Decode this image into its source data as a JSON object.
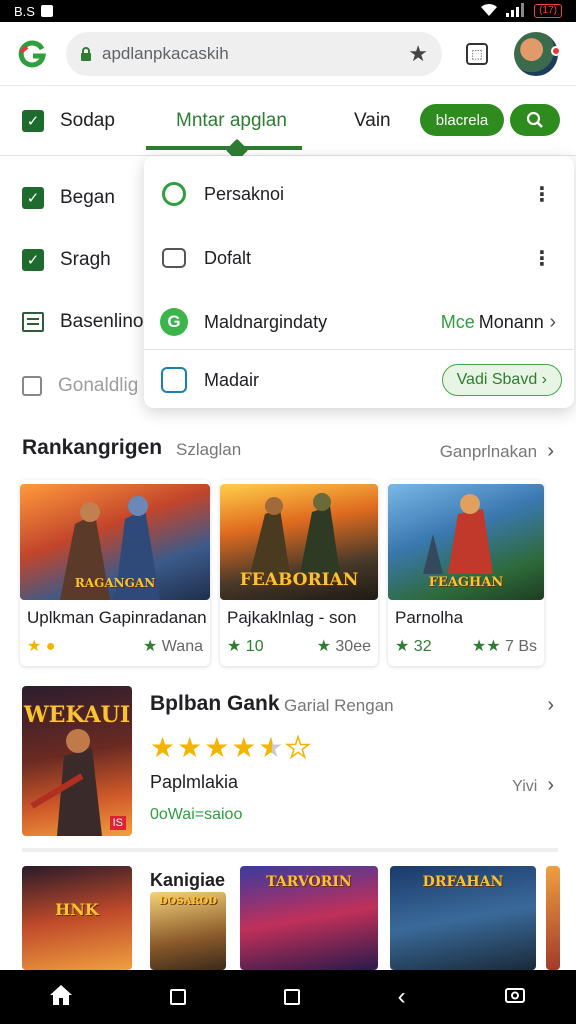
{
  "status_bar": {
    "left_text": "B.S",
    "battery": "(17)"
  },
  "browser": {
    "url": "apdlanpkacaskih",
    "star_icon": "star-icon",
    "tabs_icon": "tabs-icon"
  },
  "tabs": {
    "item1": "Sodap",
    "active": "Mntar apglan",
    "item3": "Vain",
    "pill": "blacrela"
  },
  "side": {
    "items": [
      "Began",
      "Sragh",
      "Basenlino",
      "Gonaldlig"
    ]
  },
  "dropdown": {
    "rows": [
      {
        "label": "Persaknoi"
      },
      {
        "label": "Dofalt"
      },
      {
        "label": "Maldnargindaty",
        "right_green": "Mce",
        "right_text": "Monann"
      },
      {
        "label": "Madair",
        "pill": "Vadi Sbavd"
      }
    ]
  },
  "section": {
    "title": "Rankangrigen",
    "subtitle": "Szlaglan",
    "link": "Ganprlnakan"
  },
  "cards": [
    {
      "art_text": "RAGANGAN",
      "title": "Uplkman Gapinradanan",
      "rating": "",
      "meta_right": "Wana",
      "rating_icon": "coin"
    },
    {
      "art_text": "FEABORIAN",
      "title": "Pajkaklnlag - son",
      "rating": "10",
      "meta_right": "30ee",
      "rating_icon": "star"
    },
    {
      "art_text": "FEAGHAN",
      "title": "Parnolha",
      "rating": "32",
      "meta_right": "7 Bs",
      "rating_icon": "star"
    }
  ],
  "featured": {
    "title": "Bplban Gank",
    "subtitle": "Garial Rengan",
    "stars": 4.5,
    "name": "Paplmlakia",
    "right": "Yivi",
    "price": "0oWai=saioo",
    "art_text": "WEKAUI",
    "art_badge": "IS"
  },
  "bottom": {
    "label": "Kanigiae",
    "art_texts": [
      "HNK",
      "DOSAROD",
      "TARVORIN",
      "DRFAHAN"
    ]
  },
  "colors": {
    "accent": "#2e7d32",
    "pill": "#2e8b1e",
    "star": "#f5b400"
  }
}
